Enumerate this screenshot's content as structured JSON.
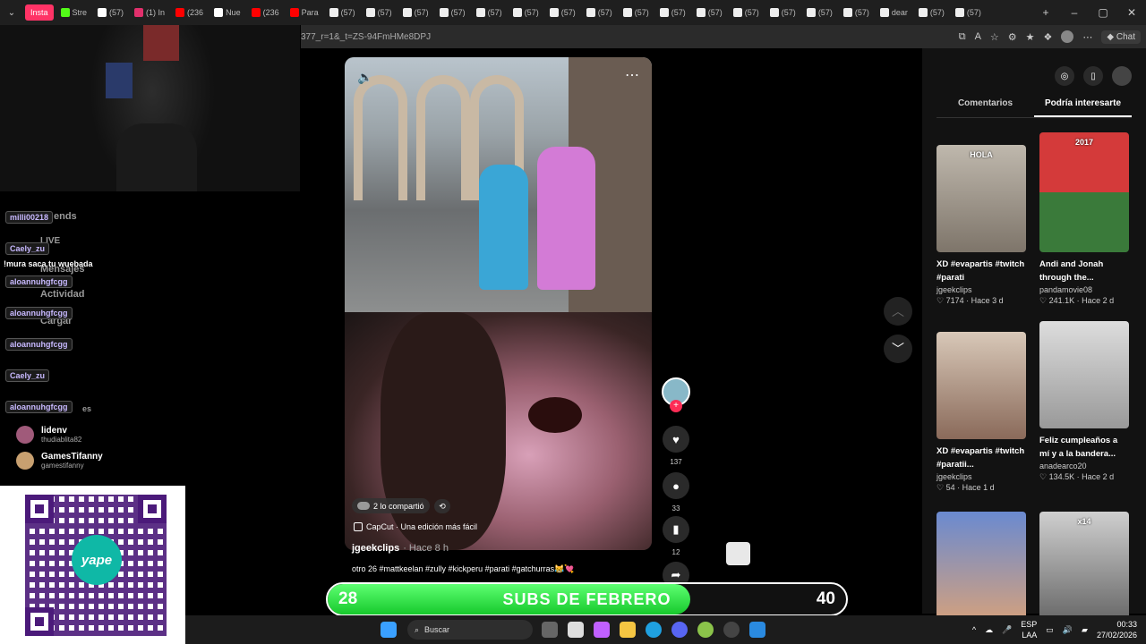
{
  "browser": {
    "tabs": [
      "Insta",
      "Stre",
      "(57)",
      "(1) In",
      "(236",
      "Nue",
      "(236",
      "Para",
      "(57)",
      "(57)",
      "(57)",
      "(57)",
      "(57)",
      "(57)",
      "(57)",
      "(57)",
      "(57)",
      "(57)",
      "(57)",
      "(57)",
      "(57)",
      "(57)",
      "(57)",
      "dear",
      "(57)",
      "(57)"
    ],
    "url": "377_r=1&_t=ZS-94FmHMe8DPJ",
    "chat_label": "Chat"
  },
  "stream_chat": {
    "ghost_lines": [
      "LIVE",
      "Mensajes",
      "Actividad",
      "Cargar"
    ],
    "ghost_ends": "ends",
    "ghost_es": "es",
    "lines": [
      {
        "user": "milli00218",
        "msg": ""
      },
      {
        "user": "Caely_zu",
        "msg": ""
      },
      {
        "user": "",
        "msg": "!mura saca tu wuebada"
      },
      {
        "user": "aloannuhgfcgg",
        "msg": ""
      },
      {
        "user": "aloannuhgfcgg",
        "msg": ""
      },
      {
        "user": "aloannuhgfcgg",
        "msg": ""
      },
      {
        "user": "Caely_zu",
        "msg": ""
      },
      {
        "user": "aloannuhgfcgg",
        "msg": ""
      }
    ],
    "followers": [
      {
        "name": "lidenv",
        "handle": "thudiablita82"
      },
      {
        "name": "GamesTifanny",
        "handle": "gamestifanny"
      }
    ]
  },
  "qr": {
    "brand": "yape"
  },
  "video": {
    "shared_label": "2 lo compartió",
    "capcut_label": "CapCut · Una edición más fácil",
    "author": "jgeekclips",
    "time": "· Hace 8 h",
    "caption": "otro 26 #mattkeelan #zully #kickperu #parati #gatchurras😹💘",
    "likes": "137",
    "comments": "33",
    "saves": "12"
  },
  "right_panel": {
    "tab_comments": "Comentarios",
    "tab_interest": "Podría interesarte",
    "cards": [
      {
        "title": "XD #evapartis #twitch #parati",
        "user": "jgeekclips",
        "meta": "♡ 7174 · Hace 3 d",
        "overlay": "HOLA"
      },
      {
        "title": "Andi and Jonah through the...",
        "user": "pandamovie08",
        "meta": "♡ 241.1K · Hace 2 d",
        "overlay": "2017"
      },
      {
        "title": "XD #evapartis #twitch #paratii...",
        "user": "jgeekclips",
        "meta": "♡ 54 · Hace 1 d",
        "overlay": ""
      },
      {
        "title": "Feliz cumpleaños a mí y a la bandera...",
        "user": "anadearco20",
        "meta": "♡ 134.5K · Hace 2 d",
        "overlay": ""
      },
      {
        "title": "",
        "user": "",
        "meta": "",
        "overlay": ""
      },
      {
        "title": "",
        "user": "",
        "meta": "",
        "overlay": "x14"
      }
    ]
  },
  "subs_goal": {
    "current": "28",
    "label": "SUBS DE FEBRERO",
    "target": "40",
    "progress": 0.7
  },
  "taskbar": {
    "search_placeholder": "Buscar",
    "lang": "ESP",
    "lang2": "LAA",
    "time": "00:33",
    "date": "27/02/2026"
  },
  "colors": {
    "accent": "#fe2c55",
    "goal_green": "#17c92c",
    "yape": "#4b1a7a"
  }
}
